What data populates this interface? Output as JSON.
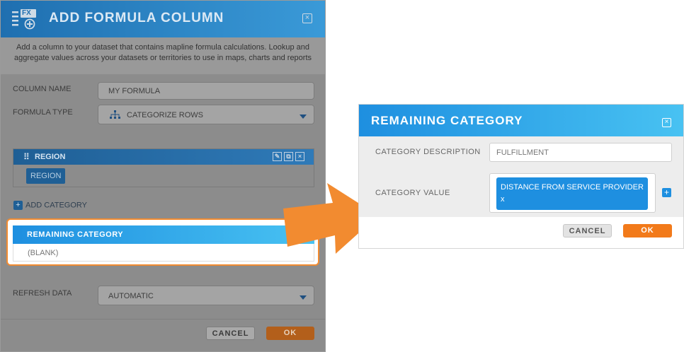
{
  "left_dialog": {
    "title": "ADD FORMULA COLUMN",
    "close_glyph": "×",
    "logo_text": "FX",
    "description": "Add a column to your dataset that contains mapline formula calculations. Lookup and aggregate values across your datasets or territories to use in maps, charts and reports",
    "column_name_label": "COLUMN NAME",
    "column_name_value": "MY FORMULA",
    "formula_type_label": "FORMULA TYPE",
    "formula_type_value": "CATEGORIZE ROWS",
    "region_card": {
      "title": "REGION",
      "tag": "REGION",
      "edit_glyph": "✎",
      "copy_glyph": "⧉",
      "delete_glyph": "×"
    },
    "add_category_label": "ADD CATEGORY",
    "add_category_glyph": "+",
    "remaining_card": {
      "title": "REMAINING CATEGORY",
      "value": "(BLANK)"
    },
    "refresh_label": "REFRESH DATA",
    "refresh_value": "AUTOMATIC",
    "cancel_label": "CANCEL",
    "ok_label": "OK"
  },
  "right_dialog": {
    "title": "REMAINING CATEGORY",
    "close_glyph": "×",
    "description_label": "CATEGORY DESCRIPTION",
    "description_value": "FULFILLMENT",
    "value_label": "CATEGORY VALUE",
    "value_chip": "DISTANCE FROM SERVICE PROVIDER",
    "value_chip_remove": "x",
    "add_value_glyph": "+",
    "cancel_label": "CANCEL",
    "ok_label": "OK"
  },
  "colors": {
    "accent_blue": "#1e8fe0",
    "accent_orange": "#f28b30",
    "overlay_gray": "#8c8c8c"
  },
  "icons": {
    "logo": "formula-fx-icon",
    "formula_type": "hierarchy-icon",
    "arrow": "right-arrow-icon"
  }
}
